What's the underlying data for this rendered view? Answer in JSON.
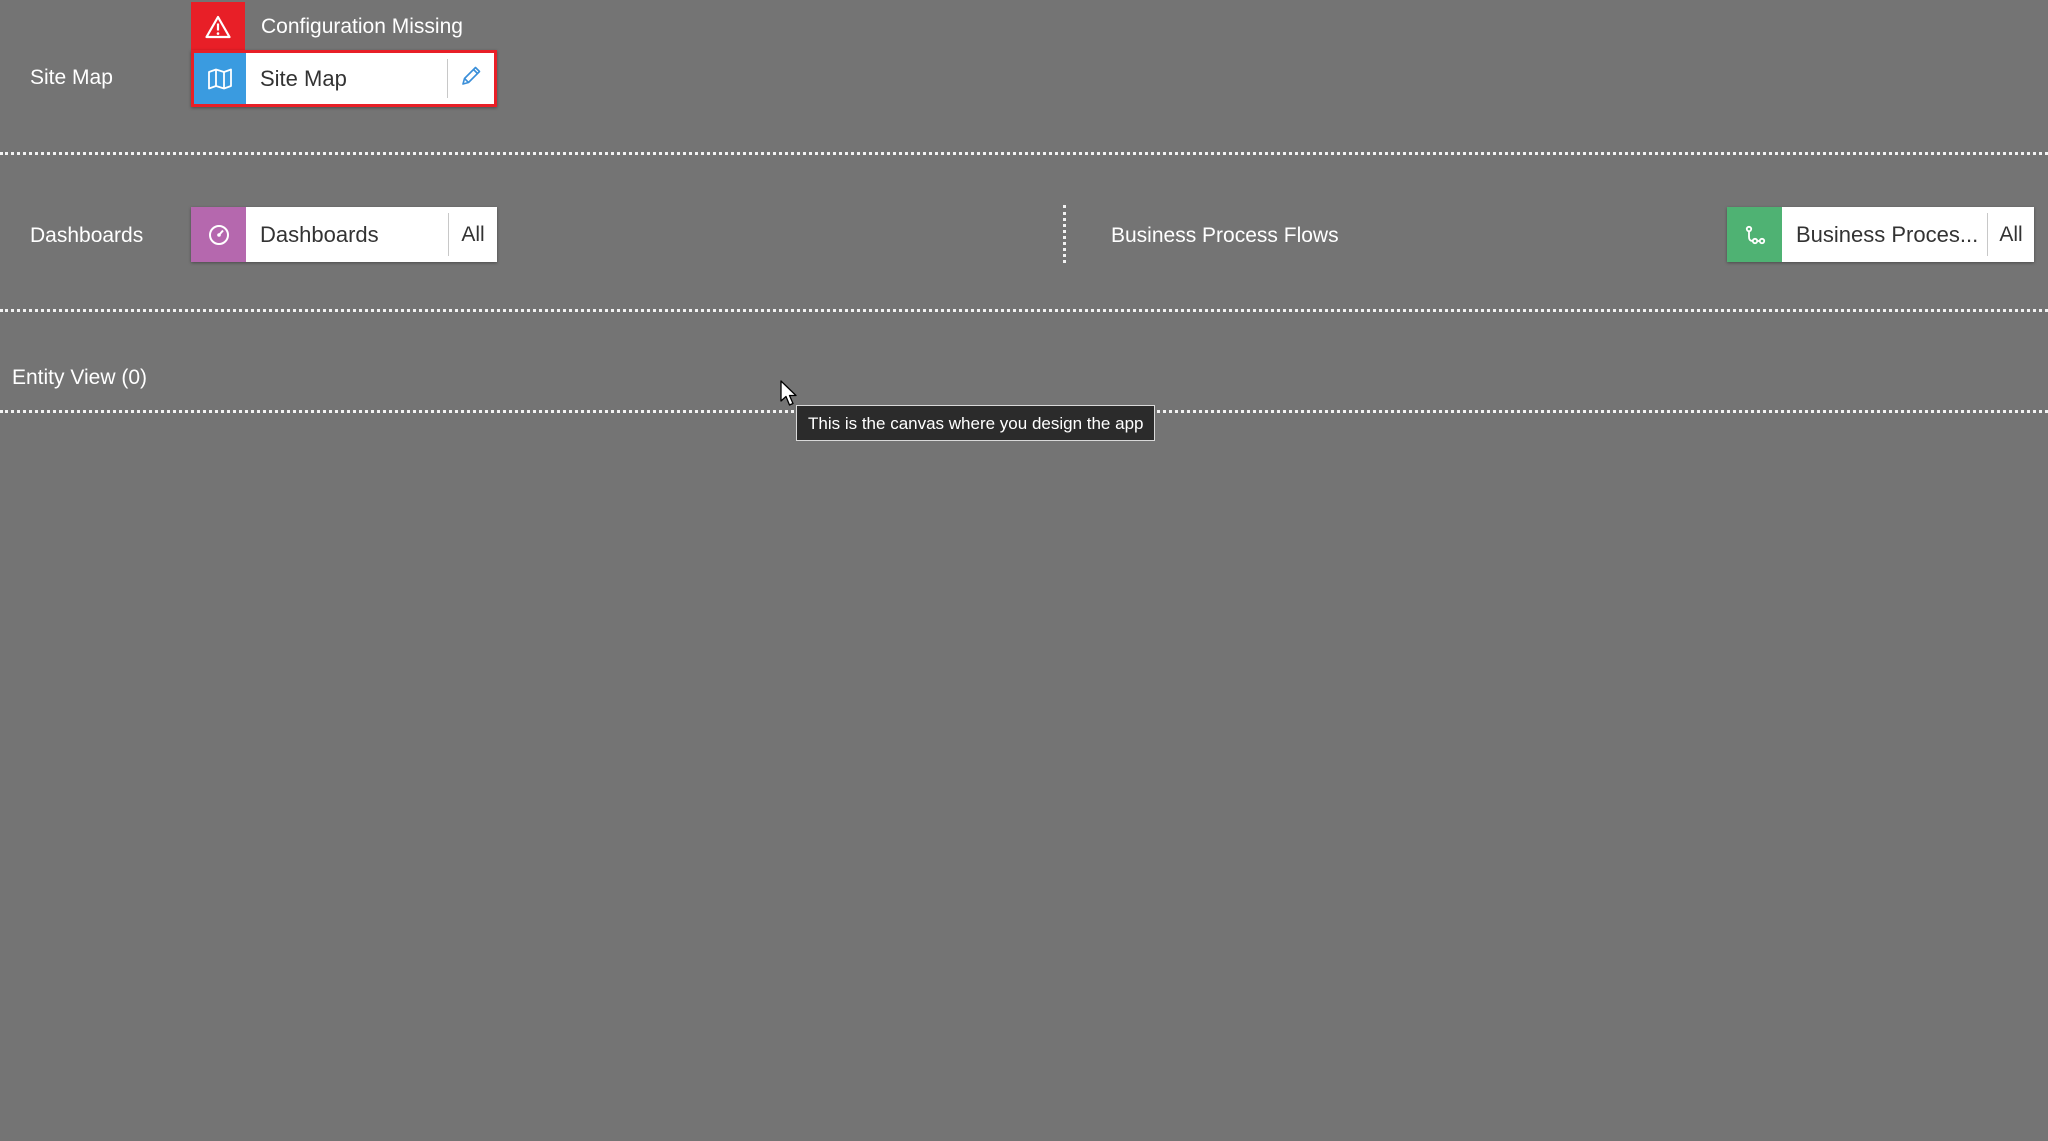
{
  "colors": {
    "canvas_background": "#747474",
    "error_red": "#e81f27",
    "site_map_blue": "#3a9be0",
    "dashboards_purple": "#b568ae",
    "bpf_green": "#4fb273"
  },
  "site_map_row": {
    "label": "Site Map",
    "warning": {
      "icon": "warning-triangle-icon",
      "text": "Configuration Missing"
    },
    "tile": {
      "icon": "map-icon",
      "name": "Site Map",
      "action_icon": "pencil-icon"
    }
  },
  "dashboards_row": {
    "label": "Dashboards",
    "tile": {
      "icon": "dashboard-gauge-icon",
      "name": "Dashboards",
      "action": "All"
    }
  },
  "bpf_row": {
    "label": "Business Process Flows",
    "tile": {
      "icon": "process-flow-icon",
      "name": "Business Proces...",
      "action": "All"
    }
  },
  "entity_view": {
    "label": "Entity View (0)"
  },
  "tooltip": {
    "text": "This is the canvas where you design the app"
  },
  "cursor": {
    "icon": "mouse-pointer-icon"
  }
}
